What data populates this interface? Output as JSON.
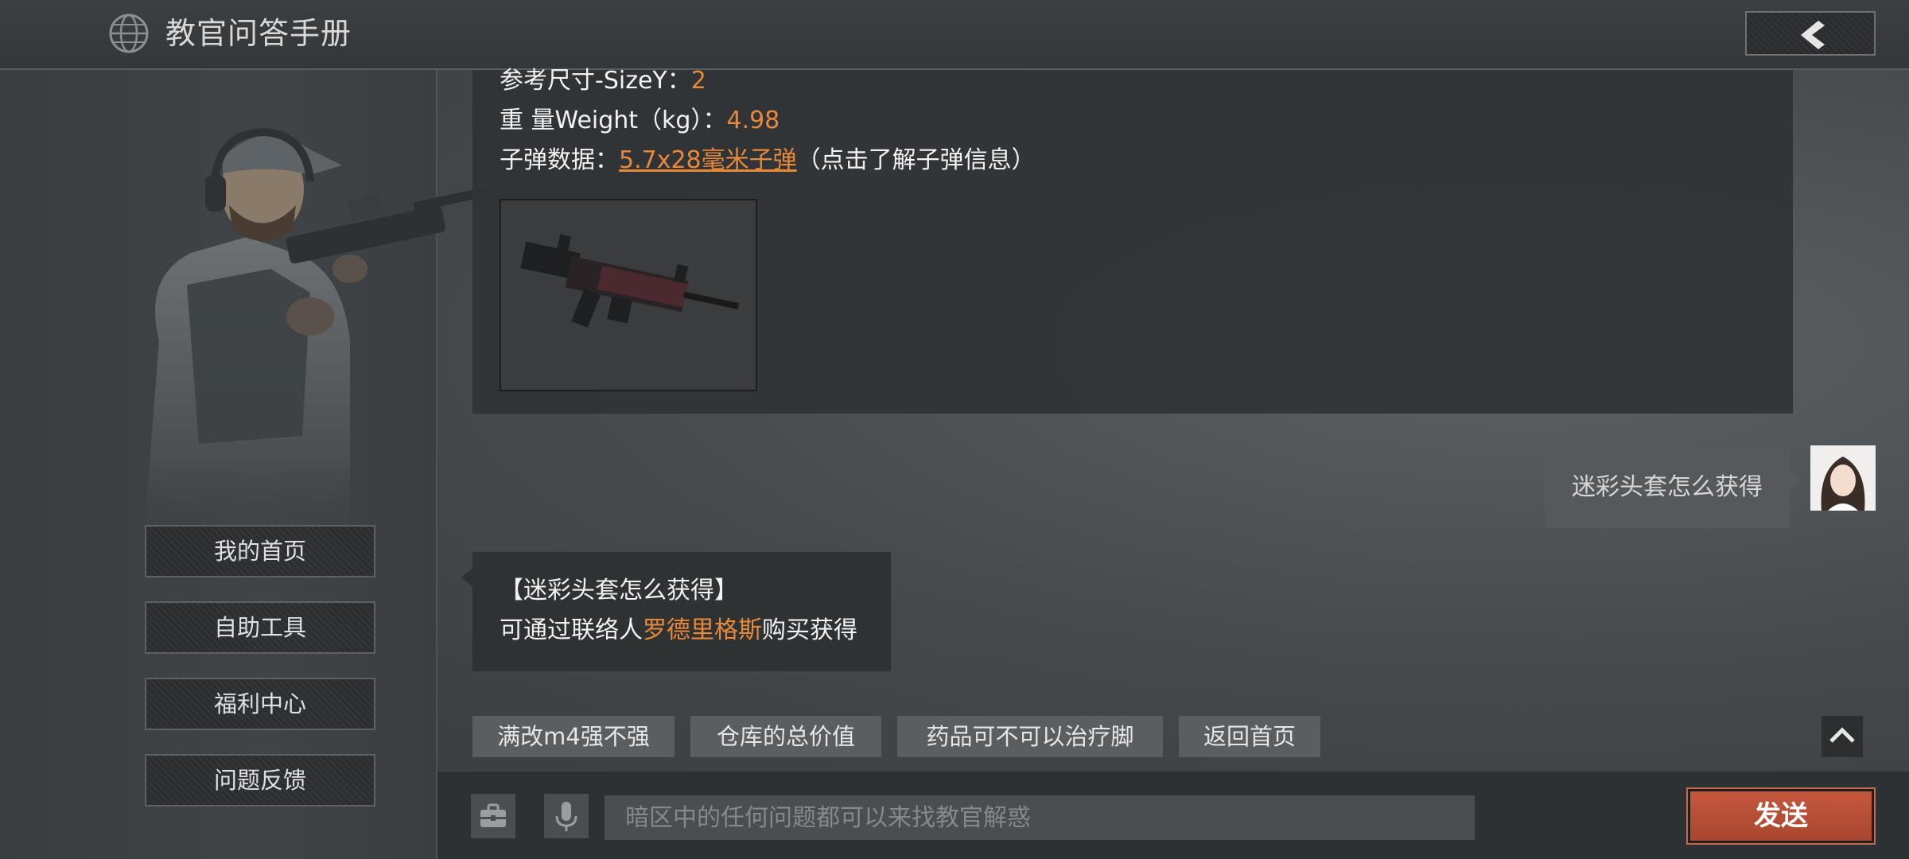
{
  "header": {
    "title": "教官问答手册",
    "globe_icon": "globe-icon",
    "back_icon": "chevron-left-icon"
  },
  "sidebar": {
    "items": [
      {
        "label": "我的首页"
      },
      {
        "label": "自助工具"
      },
      {
        "label": "福利中心"
      },
      {
        "label": "问题反馈"
      }
    ]
  },
  "weapon_card": {
    "size_label": "参考尺寸-SizeY：",
    "size_value": "2",
    "weight_label": "重 量Weight（kg）：",
    "weight_value": "4.98",
    "ammo_label": "子弹数据：",
    "ammo_link": "5.7x28毫米子弹",
    "ammo_hint": "（点击了解子弹信息）"
  },
  "user_message": {
    "text": "迷彩头套怎么获得"
  },
  "bot_reply": {
    "title": "【迷彩头套怎么获得】",
    "prefix": "可通过联络人",
    "highlight": "罗德里格斯",
    "suffix": "购买获得"
  },
  "quick_replies": [
    "满改m4强不强",
    "仓库的总价值",
    "药品可不可以治疗脚",
    "返回首页"
  ],
  "input": {
    "placeholder": "暗区中的任何问题都可以来找教官解惑",
    "send_label": "发送"
  },
  "colors": {
    "accent_orange": "#e8893a",
    "send_button": "#b54e35"
  }
}
